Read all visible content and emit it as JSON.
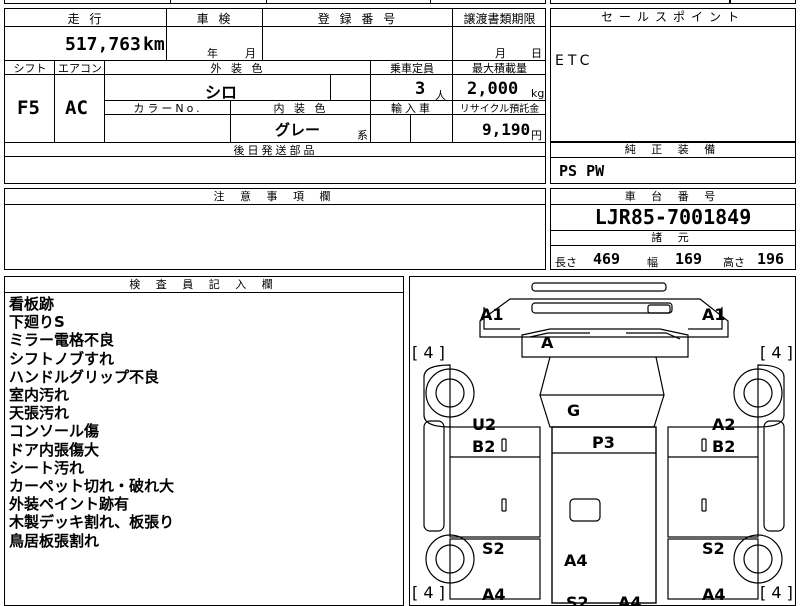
{
  "top_row": {
    "label_partial": "車検",
    "reg_partial": "登録番号"
  },
  "mileage": {
    "label": "走 行",
    "value": "517,763",
    "unit": "km"
  },
  "inspection": {
    "label": "車 検",
    "year_unit": "年",
    "month_unit": "月"
  },
  "registration": {
    "label": "登 録 番 号",
    "value": ""
  },
  "transfer": {
    "label": "譲渡書類期限",
    "month_unit": "月",
    "day_unit": "日"
  },
  "sales_point": {
    "label": "セールスポイント",
    "value": "ETC"
  },
  "shift": {
    "label": "シフト",
    "value": "F5"
  },
  "aircon": {
    "label": "エアコン",
    "value": "AC"
  },
  "exterior_color": {
    "label": "外 装 色",
    "value": "シロ"
  },
  "capacity": {
    "label": "乗車定員",
    "value": "3",
    "unit": "人"
  },
  "max_load": {
    "label": "最大積載量",
    "value": "2,000",
    "unit": "kg"
  },
  "color_no": {
    "label": "カラーNo.",
    "value": ""
  },
  "interior_color": {
    "label": "内 装 色",
    "value": "グレー",
    "suffix": "系"
  },
  "import": {
    "label": "輸入車",
    "value": ""
  },
  "recycle": {
    "label": "リサイクル預託金",
    "value": "9,190",
    "unit": "円"
  },
  "later_parts": {
    "label": "後日発送部品",
    "value": ""
  },
  "standard_equipment": {
    "label": "純 正 装 備",
    "value": "PS PW"
  },
  "notes": {
    "label": "注 意 事 項 欄",
    "value": ""
  },
  "chassis": {
    "label": "車 台 番 号",
    "value": "LJR85-7001849"
  },
  "specs": {
    "label": "諸 元",
    "length_label": "長さ",
    "length_value": "469",
    "width_label": "幅",
    "width_value": "169",
    "height_label": "高さ",
    "height_value": "196"
  },
  "inspector": {
    "label": "検 査 員 記 入 欄",
    "lines": [
      "看板跡",
      "下廻りS",
      "ミラー電格不良",
      "シフトノブすれ",
      "ハンドルグリップ不良",
      "室内汚れ",
      "天張汚れ",
      "コンソール傷",
      "ドア内張傷大",
      "シート汚れ",
      "カーペット切れ・破れ大",
      "外装ペイント跡有",
      "木製デッキ割れ、板張り",
      "鳥居板張割れ"
    ]
  },
  "diagram": {
    "tire_left_top": "[ 4 ]",
    "tire_right_top": "[ 4 ]",
    "tire_left_bottom": "[ 4 ]",
    "tire_right_bottom": "[ 4 ]",
    "marks": {
      "a1_left": "A1",
      "a1_right": "A1",
      "a_top": "A",
      "g": "G",
      "u2": "U2",
      "b2_left": "B2",
      "p3": "P3",
      "a2": "A2",
      "b2_right": "B2",
      "s2_left": "S2",
      "s2_right": "S2",
      "a4_center": "A4",
      "a4_left_bottom": "A4",
      "a4_right_bottom": "A4",
      "a4_bottom_center": "A4",
      "s2_bottom": "S2"
    }
  }
}
